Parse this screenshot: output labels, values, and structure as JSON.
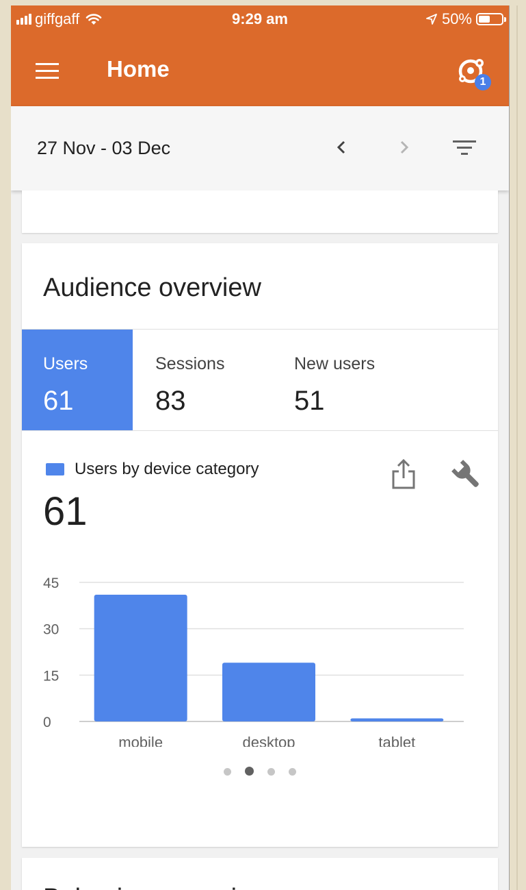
{
  "status_bar": {
    "carrier": "giffgaff",
    "time": "9:29 am",
    "battery_percent": "50%",
    "battery_level": 0.5,
    "icons": [
      "signal-icon",
      "wifi-icon",
      "location-arrow-icon",
      "battery-icon"
    ]
  },
  "app_bar": {
    "title": "Home",
    "menu_icon": "hamburger-menu-icon",
    "account_icon": "account-switcher-icon",
    "badge": "1",
    "background": "#dc6a2b"
  },
  "date_bar": {
    "range": "27 Nov - 03 Dec",
    "prev_icon": "chevron-left-icon",
    "next_icon": "chevron-right-icon",
    "filter_icon": "filter-icon"
  },
  "audience": {
    "title": "Audience overview",
    "tabs": [
      {
        "label": "Users",
        "value": "61",
        "active": true
      },
      {
        "label": "Sessions",
        "value": "83",
        "active": false
      },
      {
        "label": "New users",
        "value": "51",
        "active": false
      }
    ],
    "legend_label": "Users by device category",
    "total": "61",
    "accent": "#4f85ea",
    "share_icon": "share-icon",
    "wrench_icon": "wrench-icon",
    "pager": {
      "count": 4,
      "active_index": 1
    }
  },
  "chart_data": {
    "type": "bar",
    "categories": [
      "mobile",
      "desktop",
      "tablet"
    ],
    "values": [
      41,
      19,
      1
    ],
    "ylim": [
      0,
      45
    ],
    "yticks": [
      "0",
      "15",
      "30",
      "45"
    ],
    "grid": true,
    "color": "#4f85ea"
  },
  "next_card": {
    "title": "Behaviour overview"
  }
}
